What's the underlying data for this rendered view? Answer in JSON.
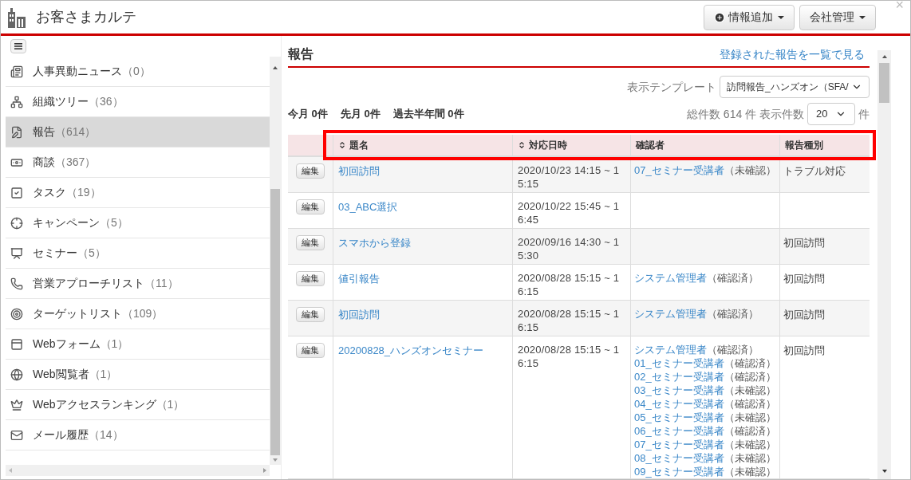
{
  "header": {
    "title": "お客さまカルテ",
    "buttons": [
      {
        "label": "情報追加",
        "kind": "add"
      },
      {
        "label": "会社管理",
        "kind": "menu"
      }
    ],
    "close": "×"
  },
  "sidebar": {
    "items": [
      {
        "label": "人事異動ニュース",
        "count": "（0）",
        "selected": false
      },
      {
        "label": "組織ツリー",
        "count": "（36）",
        "selected": false
      },
      {
        "label": "報告",
        "count": "（614）",
        "selected": true
      },
      {
        "label": "商談",
        "count": "（367）",
        "selected": false
      },
      {
        "label": "タスク",
        "count": "（19）",
        "selected": false
      },
      {
        "label": "キャンペーン",
        "count": "（5）",
        "selected": false
      },
      {
        "label": "セミナー",
        "count": "（5）",
        "selected": false
      },
      {
        "label": "営業アプローチリスト",
        "count": "（11）",
        "selected": false
      },
      {
        "label": "ターゲットリスト",
        "count": "（109）",
        "selected": false
      },
      {
        "label": "Webフォーム",
        "count": "（1）",
        "selected": false
      },
      {
        "label": "Web閲覧者",
        "count": "（1）",
        "selected": false
      },
      {
        "label": "Webアクセスランキング",
        "count": "（1）",
        "selected": false
      },
      {
        "label": "メール履歴",
        "count": "（14）",
        "selected": false
      }
    ]
  },
  "panel": {
    "title": "報告",
    "list_link": "登録された報告を一覧で見る",
    "template_label": "表示テンプレート",
    "template_value": "訪問報告_ハンズオン（SFA/",
    "counts": [
      "今月 0件",
      "先月 0件",
      "過去半年間 0件"
    ],
    "total": "総件数 614 件 表示件数",
    "page_size": "20",
    "page_size_unit": "件"
  },
  "table": {
    "columns": [
      {
        "label": "題名",
        "sortable": true
      },
      {
        "label": "対応日時",
        "sortable": true
      },
      {
        "label": "確認者",
        "sortable": false
      },
      {
        "label": "報告種別",
        "sortable": false
      }
    ],
    "rows": [
      {
        "edit_label": "編集",
        "title": "初回訪問",
        "datetime": "2020/10/23 14:15 ~ 15:15",
        "reviewers": [
          {
            "name": "07_セミナー受講者",
            "status": "（未確認）"
          }
        ],
        "type": "トラブル対応"
      },
      {
        "edit_label": "編集",
        "title": "03_ABC選択",
        "datetime": "2020/10/22 15:45 ~ 16:45"
      },
      {
        "edit_label": "編集",
        "title": "スマホから登録",
        "datetime": "2020/09/16 14:30 ~ 15:30",
        "type": "初回訪問"
      },
      {
        "edit_label": "編集",
        "title": "値引報告",
        "datetime": "2020/08/28 15:15 ~ 16:15",
        "reviewers": [
          {
            "name": "システム管理者",
            "status": "（確認済）"
          }
        ],
        "type": "初回訪問"
      },
      {
        "edit_label": "編集",
        "title": "初回訪問",
        "datetime": "2020/08/28 15:15 ~ 16:15",
        "reviewers": [
          {
            "name": "システム管理者",
            "status": "（確認済）"
          }
        ],
        "type": "初回訪問"
      },
      {
        "edit_label": "編集",
        "title": "20200828_ハンズオンセミナー",
        "datetime": "2020/08/28 15:15 ~ 16:15",
        "reviewers": [
          {
            "name": "システム管理者",
            "status": "（確認済）"
          },
          {
            "name": "01_セミナー受講者",
            "status": "（確認済）"
          },
          {
            "name": "02_セミナー受講者",
            "status": "（確認済）"
          },
          {
            "name": "03_セミナー受講者",
            "status": "（未確認）"
          },
          {
            "name": "04_セミナー受講者",
            "status": "（確認済）"
          },
          {
            "name": "05_セミナー受講者",
            "status": "（未確認）"
          },
          {
            "name": "06_セミナー受講者",
            "status": "（確認済）"
          },
          {
            "name": "07_セミナー受講者",
            "status": "（未確認）"
          },
          {
            "name": "08_セミナー受講者",
            "status": "（未確認）"
          },
          {
            "name": "09_セミナー受講者",
            "status": "（未確認）"
          }
        ],
        "type": "初回訪問"
      }
    ]
  }
}
